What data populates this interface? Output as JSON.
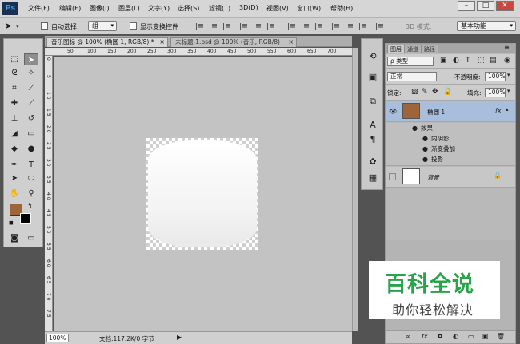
{
  "app": {
    "logo": "Ps",
    "menu": [
      "文件(F)",
      "编辑(E)",
      "图像(I)",
      "图层(L)",
      "文字(Y)",
      "选择(S)",
      "滤镜(T)",
      "3D(D)",
      "视图(V)",
      "窗口(W)",
      "帮助(H)"
    ],
    "window_controls": [
      "–",
      "□",
      "✕"
    ]
  },
  "options_bar": {
    "auto_select_label": "自动选择:",
    "auto_select_value": "组",
    "show_transform_label": "显示变换控件",
    "mode_3d_label": "3D 模式:",
    "workspace_value": "基本功能"
  },
  "tools": {
    "fg_color": "#a0643a",
    "bg_color": "#000000"
  },
  "document": {
    "tabs": [
      {
        "label": "音乐图标 @ 100% (椭圆 1, RGB/8) *",
        "active": true
      },
      {
        "label": "未标题-1.psd @ 100% (音乐, RGB/8)",
        "active": false
      }
    ],
    "ruler_top_ticks": [
      "50",
      "100",
      "150",
      "200",
      "250",
      "300",
      "350",
      "400",
      "450",
      "500",
      "550",
      "600",
      "650",
      "700"
    ],
    "ruler_left_ticks": [
      "0",
      "5",
      "1 0",
      "1 5",
      "2 0",
      "2 5",
      "3 0",
      "3 5",
      "4 0",
      "4 5",
      "5 0",
      "5 5",
      "6 0",
      "6 5",
      "7 0",
      "7 5"
    ],
    "zoom": "100%",
    "doc_info": "文档:117.2K/0 字节"
  },
  "layers_panel": {
    "tabs": [
      {
        "label": "图层",
        "active": true
      },
      {
        "label": "通道",
        "active": false
      },
      {
        "label": "路径",
        "active": false
      }
    ],
    "filter_kind": "ρ 类型",
    "blend_mode": "正常",
    "opacity_label": "不透明度:",
    "opacity_value": "100%",
    "lock_label": "锁定:",
    "fill_label": "填充:",
    "fill_value": "100%",
    "layers": [
      {
        "name": "椭圆 1",
        "thumb_color": "#a0643a",
        "fx": "fx",
        "selected": true,
        "effects_label": "效果",
        "effects": [
          "内阴影",
          "渐变叠加",
          "投影"
        ]
      },
      {
        "name": "背景",
        "thumb_color": "#ffffff",
        "locked": true,
        "selected": false
      }
    ],
    "bottom_icons": [
      "∞",
      "fx",
      "◘",
      "◐",
      "▭",
      "▣",
      "🗑"
    ]
  },
  "watermark": {
    "title": "百科全说",
    "subtitle": "助你轻松解决"
  }
}
